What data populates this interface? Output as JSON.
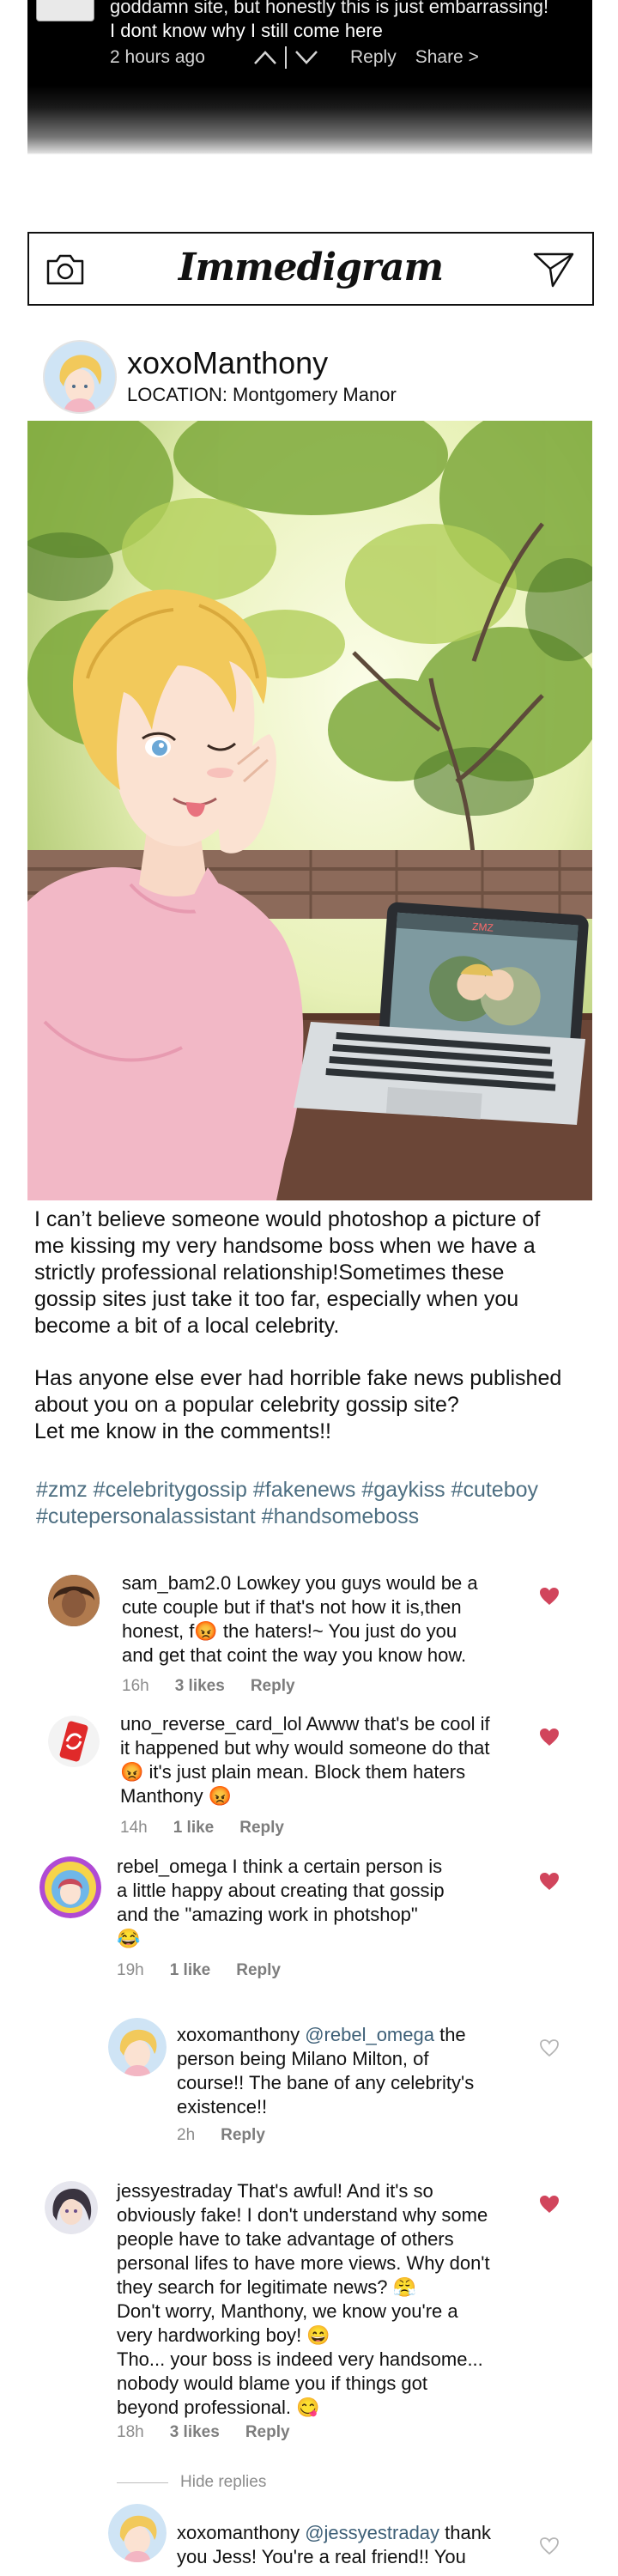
{
  "top_comment": {
    "text_line1": "goddamn site, but honestly this is just embarrassing!",
    "text_line2": "I dont know why I still come here",
    "time": "2 hours ago",
    "reply_label": "Reply",
    "share_label": "Share >"
  },
  "app": {
    "name": "Immedigram"
  },
  "post": {
    "username": "xoxoManthony",
    "location": "LOCATION: Montgomery Manor",
    "caption_p1": "I can’t believe someone would photoshop a picture of\n me kissing my very handsome boss when we have a\n strictly professional relationship!Sometimes these\ngossip sites just take it too far, especially when you\n become a bit of a local celebrity.",
    "caption_p2": "Has anyone else ever had horrible fake news published\n about you on a popular celebrity gossip site?\nLet me know in the comments!!",
    "hashtags_line1": "#zmz #celebritygossip #fakenews #gaykiss #cuteboy",
    "hashtags_line2": " #cutepersonalassistant #handsomeboss",
    "screen_brand": "ZMZ"
  },
  "comments": [
    {
      "username": "sam_bam2.0",
      "lines": [
        " Lowkey you guys would be a",
        "cute couple but if that's not how it is,then",
        "honest, f😡 the haters!~ You just do you",
        "and get that coint the way you know how."
      ],
      "time": "16h",
      "likes": "3 likes",
      "reply": "Reply",
      "liked": true
    },
    {
      "username": "uno_reverse_card_lol",
      "lines": [
        " Awww that's be cool if",
        "it happened but why would someone do that",
        "😡 it's just plain mean. Block them haters",
        "Manthony 😡"
      ],
      "time": "14h",
      "likes": "1 like",
      "reply": "Reply",
      "liked": true
    },
    {
      "username": "rebel_omega",
      "lines": [
        " I think a certain person is",
        " a little happy about creating that gossip",
        " and the \"amazing work in photshop\"",
        "😂"
      ],
      "time": "19h",
      "likes": "1 like",
      "reply": "Reply",
      "liked": true
    },
    {
      "username": "xoxomanthony",
      "mention": " @rebel_omega",
      "lines": [
        " the",
        "person being Milano Milton, of",
        "course!! The bane of any celebrity's",
        "existence!!"
      ],
      "time": "2h",
      "likes": "",
      "reply": "Reply",
      "liked": false
    },
    {
      "username": "jessyestraday",
      "lines": [
        " That's awful! And it's so",
        "obviously fake! I don't understand why some",
        "people have to take advantage of others",
        "personal lifes to have more views. Why don't",
        "they search for legitimate news? 😤",
        "Don't worry, Manthony, we know you're a",
        "very hardworking boy! 😄",
        "Tho... your boss is indeed very handsome...",
        "nobody would blame you if things got",
        "beyond professional. 😋"
      ],
      "time": "18h",
      "likes": "3 likes",
      "reply": "Reply",
      "liked": true
    },
    {
      "username": "xoxomanthony",
      "mention": " @jessyestraday",
      "lines": [
        " thank",
        "you Jess! You're a real friend!! You"
      ],
      "time": "",
      "likes": "",
      "reply": "",
      "liked": false
    }
  ],
  "hide_replies_label": "Hide replies",
  "colors": {
    "hashtag": "#4e6f82",
    "heart_liked": "#d1455c",
    "heart_outline": "#b5b5b5",
    "mention": "#3d5f77"
  }
}
